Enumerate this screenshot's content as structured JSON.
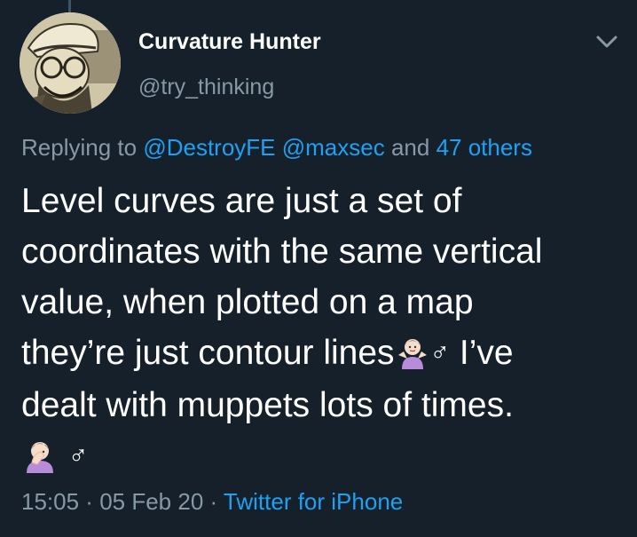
{
  "user": {
    "display_name": "Curvature Hunter",
    "handle": "@try_thinking"
  },
  "reply": {
    "prefix": "Replying to ",
    "mentions": [
      "@DestroyFE",
      "@maxsec"
    ],
    "joiner": " and ",
    "others": "47 others"
  },
  "tweet": {
    "lines": [
      "Level curves are just a set of",
      "coordinates with the same vertical",
      "value, when plotted on a map",
      "they’re just contour lines",
      "dealt with muppets lots of times."
    ],
    "after_shrug": " I’ve",
    "male_sign": "♂"
  },
  "meta": {
    "time": "15:05",
    "separator": " · ",
    "date": "05 Feb 20",
    "source": "Twitter for iPhone"
  },
  "icons": {
    "menu": "chevron-down-icon",
    "emoji_1": "person-shrugging-emoji",
    "emoji_2": "person-facepalming-emoji"
  },
  "colors": {
    "background": "#15202b",
    "text": "#ffffff",
    "muted": "#8899a6",
    "link": "#1da1f2"
  }
}
